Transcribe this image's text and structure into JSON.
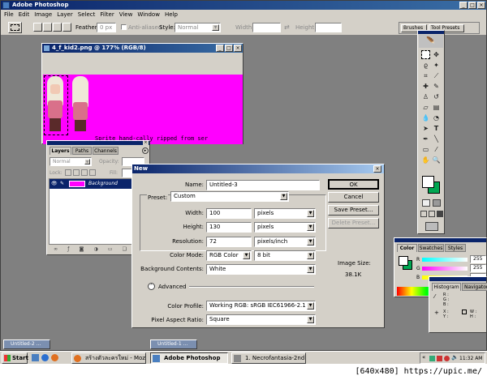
{
  "app": {
    "title": "Adobe Photoshop",
    "menu": [
      "File",
      "Edit",
      "Image",
      "Layer",
      "Select",
      "Filter",
      "View",
      "Window",
      "Help"
    ]
  },
  "options_bar": {
    "feather_label": "Feather:",
    "feather_value": "0 px",
    "antialiased_label": "Anti-aliased",
    "style_label": "Style:",
    "style_value": "Normal",
    "width_label": "Width:",
    "height_label": "Height:",
    "tab_brushes": "Brushes",
    "tab_presets": "Tool Presets"
  },
  "document": {
    "title": "4_f_kid2.png @ 177% (RGB/8)",
    "caption_text": "Sprite hand-cally ripped from ser"
  },
  "layers_panel": {
    "tabs": [
      "Layers",
      "Paths",
      "Channels"
    ],
    "blend_mode": "Normal",
    "opacity_label": "Opacity:",
    "lock_label": "Lock:",
    "fill_label": "Fill:",
    "layer_name": "Background"
  },
  "new_dialog": {
    "title": "New",
    "name_label": "Name:",
    "name_value": "Untitled-3",
    "preset_label": "Preset:",
    "preset_value": "Custom",
    "width_label": "Width:",
    "width_value": "100",
    "width_unit": "pixels",
    "height_label": "Height:",
    "height_value": "130",
    "height_unit": "pixels",
    "resolution_label": "Resolution:",
    "resolution_value": "72",
    "resolution_unit": "pixels/inch",
    "color_mode_label": "Color Mode:",
    "color_mode_value": "RGB Color",
    "bit_depth": "8 bit",
    "bg_contents_label": "Background Contents:",
    "bg_contents_value": "White",
    "advanced_label": "Advanced",
    "color_profile_label": "Color Profile:",
    "color_profile_value": "Working RGB:  sRGB IEC61966-2.1",
    "pixel_aspect_label": "Pixel Aspect Ratio:",
    "pixel_aspect_value": "Square",
    "ok_label": "OK",
    "cancel_label": "Cancel",
    "save_preset_label": "Save Preset...",
    "delete_preset_label": "Delete Preset...",
    "image_size_label": "Image Size:",
    "image_size_value": "38.1K"
  },
  "color_panel": {
    "tabs": [
      "Color",
      "Swatches",
      "Styles"
    ],
    "channels": [
      "R",
      "G",
      "B"
    ],
    "values": [
      "255",
      "255",
      ""
    ]
  },
  "histogram_panel": {
    "tabs": [
      "Histogram",
      "Navigator"
    ],
    "readout_labels": [
      "R :",
      "G :",
      "B :",
      "X :",
      "Y :",
      "W :",
      "H :"
    ]
  },
  "minimized_docs": [
    "Untitled-2 ...",
    "Untitled-1 ..."
  ],
  "taskbar": {
    "start_label": "Start",
    "tasks": [
      "สร้างตัวละครใหม่ - Mozilla Fi...",
      "Adobe Photoshop",
      "1. Necrofantasia-2nd Cu..."
    ],
    "clock": "11:32 AM"
  },
  "watermark": "[640x480] https://upic.me/",
  "colors": {
    "title_blue": "#0a246a",
    "canvas_magenta": "#ff00ff",
    "workspace_gray": "#808080",
    "foreground_swatch": "#ffffff",
    "background_swatch": "#00a651"
  }
}
